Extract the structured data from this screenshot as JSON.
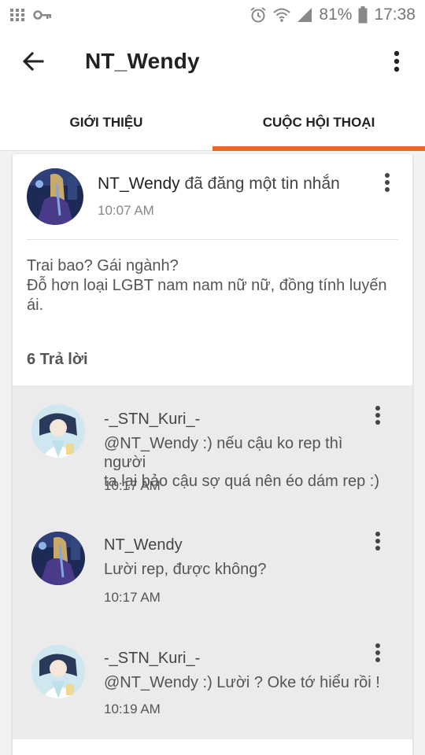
{
  "status_bar": {
    "battery_percent": "81%",
    "time": "17:38",
    "icons": [
      "grid-icon",
      "key-icon",
      "alarm-icon",
      "wifi-icon",
      "signal-icon",
      "battery-icon"
    ]
  },
  "app_bar": {
    "title": "NT_Wendy",
    "back_icon": "arrow-left-icon",
    "more_icon": "more-vert-icon"
  },
  "tabs": [
    {
      "label": "GIỚI THIỆU",
      "active": false
    },
    {
      "label": "CUỘC HỘI THOẠI",
      "active": true
    }
  ],
  "colors": {
    "accent": "#f26522",
    "avatar_dark": "#1c2a55",
    "avatar_light": "#cfe7ef"
  },
  "post": {
    "author": "NT_Wendy",
    "action": " đã đăng một tin nhắn",
    "time": "10:07 AM",
    "body_lines": [
      "Trai bao? Gái ngành?",
      "Đỗ hơn loại LGBT nam nam nữ nữ, đồng tính luyến",
      "ái."
    ],
    "reply_count": "6 Trả lời"
  },
  "replies": [
    {
      "author": "-_STN_Kuri_-",
      "lines": [
        "@NT_Wendy  :) nếu cậu ko rep thì người",
        "ta lại bảo cậu sợ quá nên éo dám rep :)"
      ],
      "time": "10:17 AM"
    },
    {
      "author": "NT_Wendy",
      "lines": [
        "Lười rep, được không?"
      ],
      "time": "10:17 AM"
    },
    {
      "author": "-_STN_Kuri_-",
      "lines": [
        "@NT_Wendy  :) Lười ? Oke tớ hiểu rồi !"
      ],
      "time": "10:19 AM"
    }
  ]
}
